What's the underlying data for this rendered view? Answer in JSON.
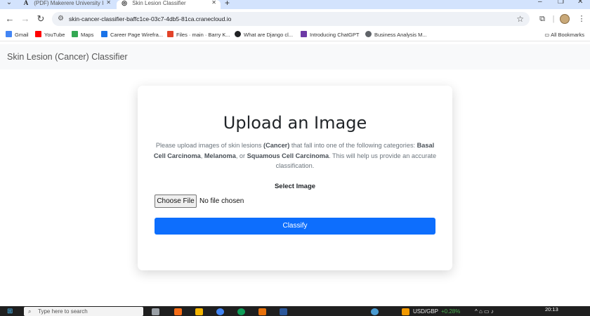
{
  "browser": {
    "tabs": [
      {
        "title": "(PDF) Makerere University Infor",
        "icon": "academia-icon"
      },
      {
        "title": "Skin Lesion Classifier",
        "icon": "globe-icon"
      }
    ],
    "url": "skin-cancer-classifier-baffc1ce-03c7-4db5-81ca.cranecloud.io",
    "bookmarks": [
      {
        "label": "Gmail",
        "color": "#ea4335"
      },
      {
        "label": "YouTube",
        "color": "#ff0000"
      },
      {
        "label": "Maps",
        "color": "#34a853"
      },
      {
        "label": "Career Page Wirefra...",
        "color": "#1a73e8"
      },
      {
        "label": "Files · main · Barry K...",
        "color": "#e24329"
      },
      {
        "label": "What are Django cl...",
        "color": "#202124"
      },
      {
        "label": "Introducing ChatGPT",
        "color": "#6e3aa6"
      },
      {
        "label": "Business Analysis M...",
        "color": "#5f6368"
      }
    ],
    "all_bookmarks": "All Bookmarks"
  },
  "app": {
    "brand": "Skin Lesion (Cancer) Classifier"
  },
  "upload": {
    "heading": "Upload an Image",
    "desc_intro": "Please upload images of skin lesions ",
    "desc_cancer": "(Cancer)",
    "desc_mid": " that fall into one of the following categories: ",
    "cat_1": "Basal Cell Carcinoma",
    "cat_sep_1": ", ",
    "cat_2": "Melanoma",
    "cat_sep_2": ", or ",
    "cat_3": "Squamous Cell Carcinoma",
    "desc_end": ". This will help us provide an accurate classification.",
    "select_label": "Select Image",
    "choose_file": "Choose File",
    "file_status": "No file chosen",
    "classify": "Classify"
  },
  "taskbar": {
    "search_placeholder": "Type here to search",
    "ticker": "USD/GBP",
    "ticker_change": "+0.28%",
    "time": "20:13"
  },
  "colors": {
    "primary": "#0d6efd",
    "tabstrip": "#d3e3fd"
  }
}
